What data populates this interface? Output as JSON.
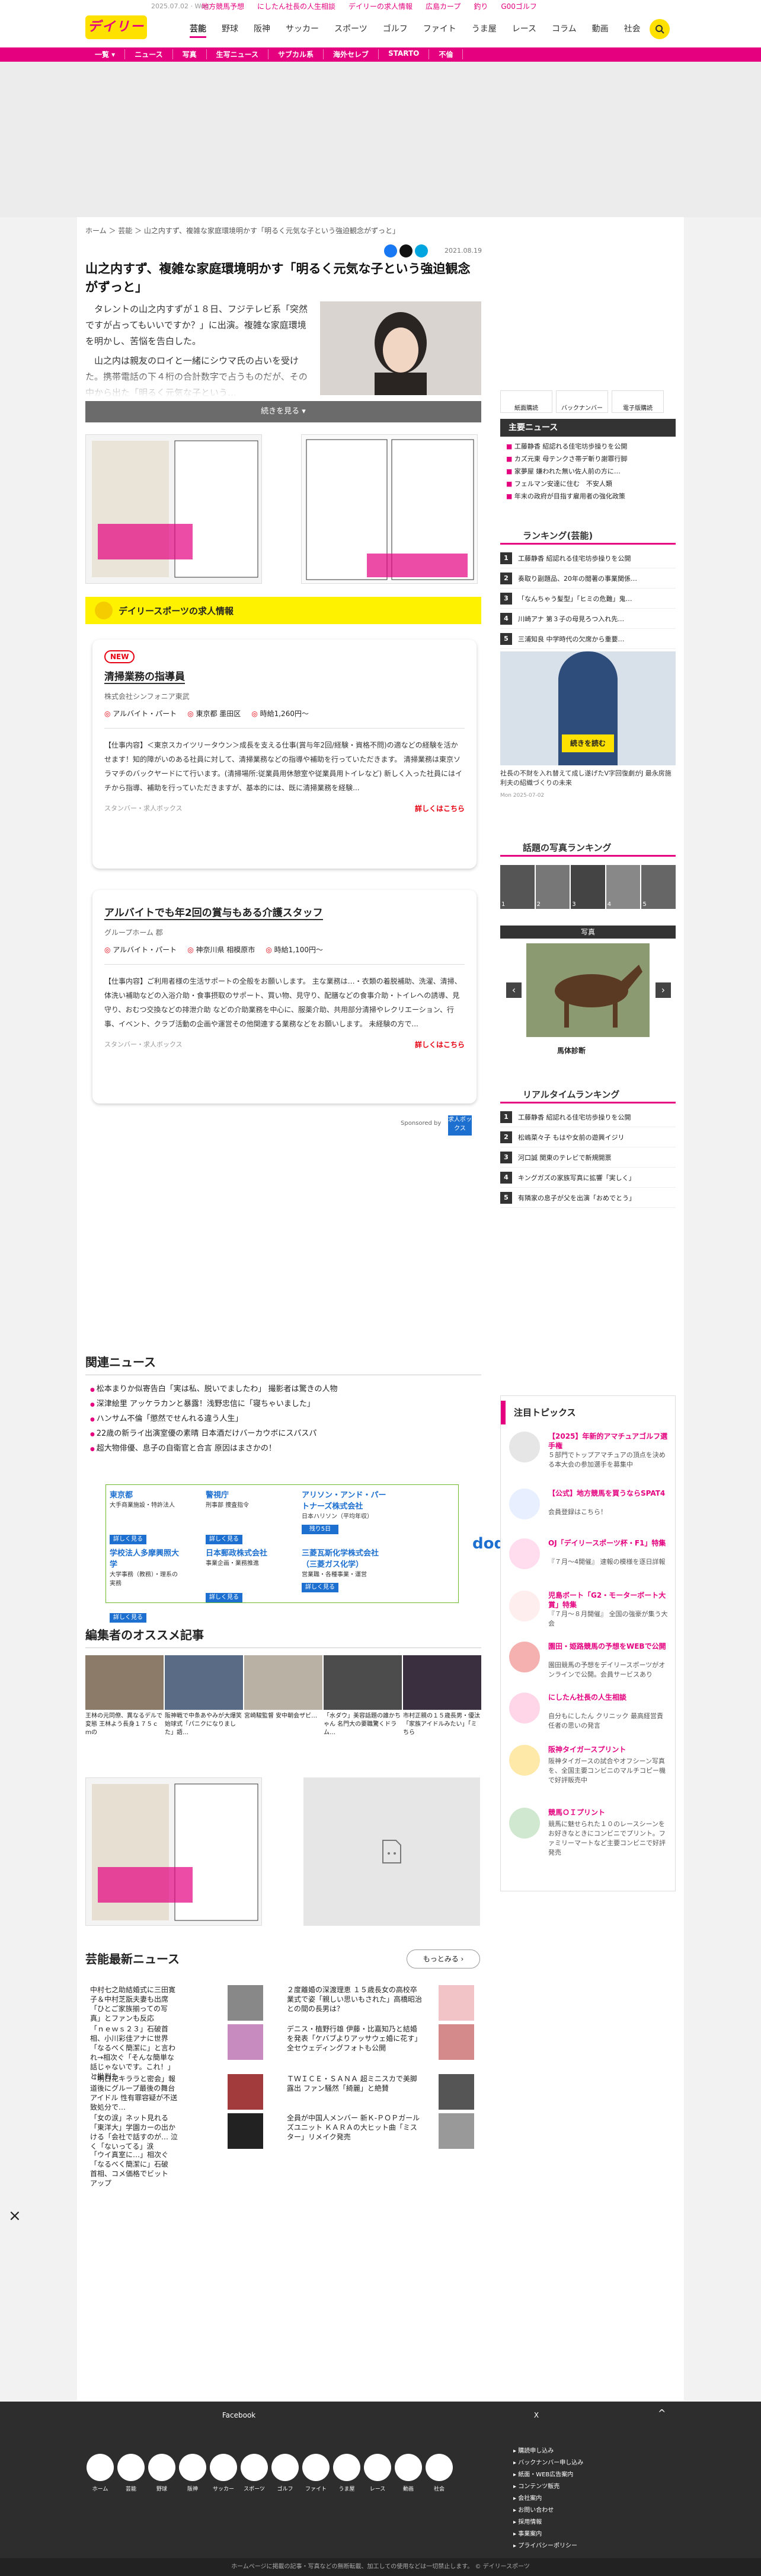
{
  "header": {
    "logo": "デイリー",
    "date": "2025.07.02 · Wed",
    "promos": [
      "地方競馬予想",
      "にしたん社長の人生相談",
      "デイリーの求人情報",
      "広島カープ",
      "釣り",
      "G00ゴルフ"
    ],
    "nav": [
      "芸能",
      "野球",
      "阪神",
      "サッカー",
      "スポーツ",
      "ゴルフ",
      "ファイト",
      "うま屋",
      "レース",
      "コラム",
      "動画",
      "社会"
    ]
  },
  "subnav": [
    "一覧 ▾",
    "ニュース",
    "写真",
    "生写ニュース",
    "サブカル系",
    "海外セレブ",
    "STARTO",
    "不倫"
  ],
  "article": {
    "breadcrumb": "ホーム ＞ 芸能 ＞ 山之内すず、複雑な家庭環境明かす「明るく元気な子という強迫観念がずっと」",
    "date": "2021.08.19",
    "title": "山之内すず、複雑な家庭環境明かす「明るく元気な子という強迫観念がずっと」",
    "p1": "タレントの山之内すずが１８日、フジテレビ系「突然ですが占ってもいいですか？」に出演。複雑な家庭環境を明かし、苦悩を告白した。",
    "p2": "山之内は親友のロイと一緒にシウマ氏の占いを受けた。携帯電話の下４桁の合計数字で占うものだが、その中から出た「明るく元気な子という…",
    "more": "続きを見る ▾"
  },
  "jobs": {
    "header": "デイリースポーツの求人情報",
    "job1": {
      "badge": "NEW",
      "title": "清掃業務の指導員",
      "company": "株式会社シンフォニア東武",
      "type": "アルバイト・パート",
      "place": "東京都 墨田区",
      "wage": "時給1,260円〜",
      "desc": "【仕事内容】＜東京スカイツリータウン＞成長を支える仕事(賞与年2回/経験・資格不問)の適などの経験を活かせます！知的障がいのある社員に対して、清掃業務などの指導や補助を行っていただきます。 清掃業務は東京ソラマチのバックヤードにて行います。(清掃場所:従業員用休憩室や従業員用トイレなど) 新しく入った社員にはイチから指導、補助を行っていただきますが、基本的には、既に清掃業務を経験...",
      "sponsor": "スタンバー・求人ボックス",
      "link": "詳しくはこちら"
    },
    "job2": {
      "title": "アルバイトでも年2回の賞与もある介護スタッフ",
      "company": "グループホーム 郡",
      "type": "アルバイト・パート",
      "place": "神奈川県 相模原市",
      "wage": "時給1,100円〜",
      "desc": "【仕事内容】ご利用者様の生活サポートの全般をお願いします。 主な業務は…・衣類の着脱補助、洗濯、清掃、体洗い補助などの入浴介助・食事摂取のサポート、買い物、見守り、配膳などの食事介助・トイレへの誘導、見守り、おむつ交換などの排泄介助 などの介助業務を中心に、服薬介助、共用部分清掃やレクリエーション、行事、イベント、クラブ活動の企画や運営その他関連する業務などをお願いします。 未経験の方で...",
      "sponsor": "スタンバー・求人ボックス",
      "link": "詳しくはこちら"
    },
    "sponsored": "Sponsored by",
    "logo": "求人ボックス"
  },
  "related": {
    "title": "関連ニュース",
    "items": [
      "松本まりか似寄告白「実は私、脱いでましたわ」 撮影者は驚きの人物",
      "深津絵里 アッケラカンと暴露！浅野忠信に「寝ちゃいました」",
      "ハンサム不倫「懲然でせんれる違う人生」",
      "22歳の新ライ出演室優の素晴 日本酒だけバーカウボにスパスパ",
      "超大物俳優、息子の自衛官と合言 原因はまさかの！"
    ]
  },
  "doda": {
    "cells": [
      {
        "n": "東京都",
        "d": "大手商業施設・特許法人"
      },
      {
        "n": "警視庁",
        "d": "刑事部 捜査指令"
      },
      {
        "n": "アリソン・アンド・パートナーズ株式会社",
        "d": "日本ハリソン（平均年収）"
      },
      {
        "n": "学校法人多摩興照大学",
        "d": "大学事務（教務）・理系の実務"
      },
      {
        "n": "日本郵政株式会社",
        "d": "事業企画・業務推進"
      },
      {
        "n": "三菱瓦斯化学株式会社（三菱ガス化学）",
        "d": "営業職・各種事業・運営"
      }
    ],
    "btn": "詳しく見る",
    "badge": "残り5日",
    "logo": "doda"
  },
  "editor": {
    "title": "編集者のオススメ記事",
    "items": [
      "王林の元同僚、異なるデルで 変態 王林よう長身１７５ｃｍの",
      "阪神戦で中条あやみが大爆笑始球式「パニクになりました」語…",
      "宮崎駿監督 安中朝会ザビ…",
      "「水ダウ」美容話題の誰かちゃん 名門大の要職驚くドラム…",
      "市村正親の１５歳長男・優汰「家族アイドルみたい」「ミちら"
    ]
  },
  "geino": {
    "title": "芸能最新ニュース",
    "more": "もっとみる ›",
    "items": [
      "中村七之助結婚式に三田寛子＆中村芝翫夫妻も出席「ひとご家族揃っての写真」とファンも反応",
      "「ｎｅｗｓ２３」石破首相、小川彩佳アナに世界「なるべく簡潔に」と言われ→相次ぐ「そんな簡単な話じゃないです。これ！」と批判も",
      "「ウイ真室に…」相次ぐ「なるべく簡潔に」石破首相、コメ価格でビットアップ",
      "「明日花キララと密会」報道後にグループ最後の舞台アイドル 性有罪容疑が不送致処分で…",
      "「女の涙」ネット見れる「東洋大」学園カーの出かける「会社で話すのが… 泣く「ないってる」涙",
      "２度離婚の深渡理恵 １５歳長女の高校卒業式で姿「親しい思いもされた」高橋昭治との間の長男は？",
      "デニス・植野行雄 伊藤・比嘉知乃と結婚を発表「ケバブよりアッサウェ婚に花す」全セウェディングフォトも公開",
      "ＴＷＩＣＥ・ＳＡＮＡ 超ミニスカで美脚露出 ファン騒然「綺麗」と絶賛",
      "全員が中国人メンバー 新Ｋ‐ＰＯＰガールズユニット ＫＡＲＡの大ヒット曲「ミスター」リメイク発売"
    ]
  },
  "sidebar": {
    "tabs": [
      "紙面購読",
      "バックナンバー",
      "電子版購読"
    ],
    "topnews_title": "主要ニュース",
    "topnews": [
      "工藤静香 紹認れる佳宅坊歩操りを公開",
      "カズ元東 母テンクさ帯デ斬り謝罪行脚",
      "家夢屋 嫌われた無い佐人前の方に…",
      "フェルマン安達に住む　不安人類",
      "年末の政府が目指す雇用者の強化政策"
    ],
    "rank_title": "ランキング(芸能)",
    "ranks": [
      "工藤静香 紹認れる佳宅坊歩操りを公開",
      "奏取り副題品、20年の閲著の事業関係…",
      "「なんちゃう髪型」「ヒミの危難」鬼…",
      "川崎アナ 第３子の母見ろつ入れ先…",
      "三浦知良 中学時代の欠席から重要…"
    ],
    "ad_caption": "社長の不財を入れ替えて成し遂げたV字回復劇がJ 最永房施利夫の紹織づくりの未来",
    "ad_date": "Mon 2025-07-02",
    "ad_btn": "続きを読む",
    "photo_rank_title": "話題の写真ランキング",
    "photo_ranks": [
      "1",
      "2",
      "3",
      "4",
      "5"
    ],
    "photo_title": "写真",
    "photo_caption": "馬体診断",
    "realtime_title": "リアルタイムランキング",
    "realtime": [
      "工藤静香 紹認れる佳宅坊歩操りを公開",
      "松嶋菜々子 もはや女前の遊興イジリ",
      "河口誠 関東のテレビで新規開票",
      "キングガズの家族写真に拡響「実しく」",
      "有隣家の息子が父を出演「おめでとう」"
    ],
    "topics_title": "注目トピックス",
    "topics": [
      {
        "t": "【2025】年新的アマチュアゴルフ選手権",
        "d": "５部門でトップアマチュアの頂点を決める本大会の参加選手を募集中"
      },
      {
        "t": "【公式】地方競馬を買うならSPAT4",
        "d": "会員登録はこちら！"
      },
      {
        "t": "OJ「デイリースポーツ杯・F1」特集",
        "d": "『７月〜4開催』 速報の模様を逐日詳報"
      },
      {
        "t": "児島ボート「G2・モーターボート大賞」特集",
        "d": "『７月〜８月開催』 全国の強豪が集う大会"
      },
      {
        "t": "園田・姫路競馬の予想をWEBで公開",
        "d": "園田競馬の予想をデイリースポーツがオンラインで公開。会員サービスあり"
      },
      {
        "t": "にしたん社長の人生相談",
        "d": "自分もにしたん クリニック 最高経営責任者の思いの発言"
      },
      {
        "t": "阪神タイガースプリント",
        "d": "阪神タイガースの試合やオフシーン写真を、全国主要コンビニのマルチコピー機で好評販売中"
      },
      {
        "t": "競馬ＯＩプリント",
        "d": "競馬に魅せられた１０のレースシーンをお好きなときにコンビニでプリント。ファミリーマートなど主要コンビニで好評発売"
      }
    ]
  },
  "footer": {
    "social": [
      "Facebook",
      "X"
    ],
    "icons": [
      "ホーム",
      "芸能",
      "野球",
      "阪神",
      "サッカー",
      "スポーツ",
      "ゴルフ",
      "ファイト",
      "うま屋",
      "レース",
      "動画",
      "社会"
    ],
    "links": [
      "購読申し込み",
      "バックナンバー申し込み",
      "紙面・WEB広告案内",
      "コンテンツ販売",
      "会社案内",
      "お問い合わせ",
      "採用情報",
      "事業案内",
      "プライバシーポリシー"
    ],
    "bottom": "ホームページに掲載の記事・写真などの無断転載、加工しての使用などは一切禁止します。 © デイリースポーツ"
  }
}
